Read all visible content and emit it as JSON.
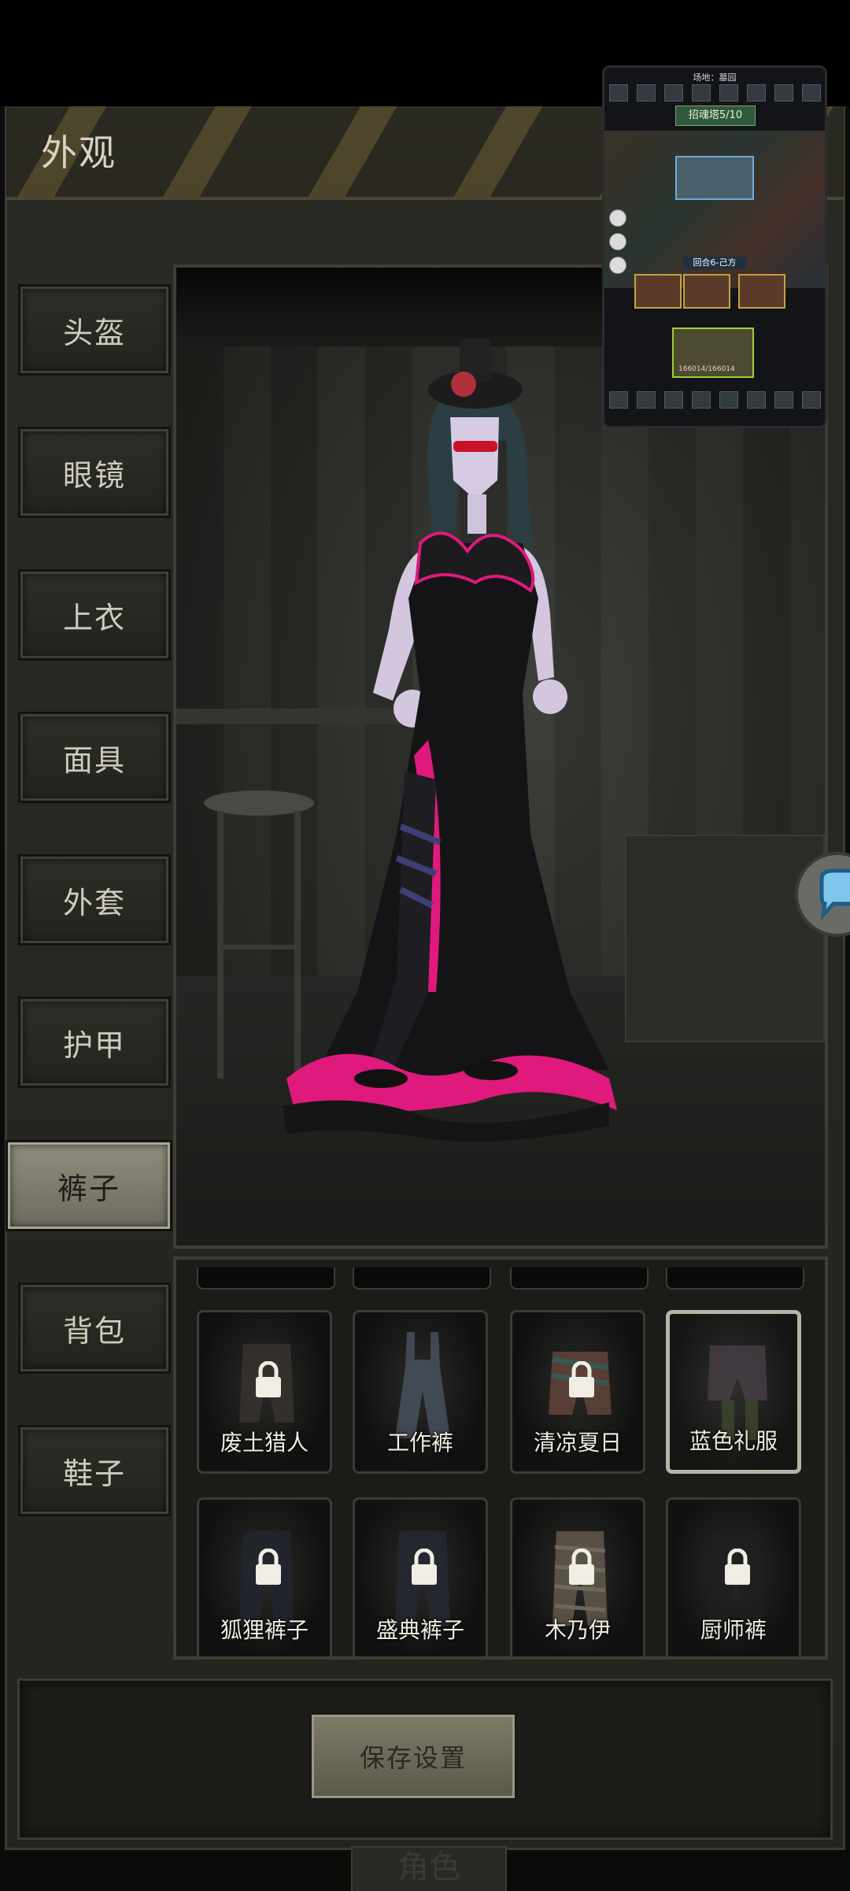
{
  "header": {
    "title": "外观"
  },
  "categories": [
    "头盔",
    "眼镜",
    "上衣",
    "面具",
    "外套",
    "护甲",
    "裤子",
    "背包",
    "鞋子"
  ],
  "active_category": "裤子",
  "items": [
    {
      "label": "废土猎人",
      "locked": true,
      "selected": false
    },
    {
      "label": "工作裤",
      "locked": false,
      "selected": false
    },
    {
      "label": "清凉夏日",
      "locked": true,
      "selected": false
    },
    {
      "label": "蓝色礼服",
      "locked": false,
      "selected": true
    },
    {
      "label": "狐狸裤子",
      "locked": true,
      "selected": false
    },
    {
      "label": "盛典裤子",
      "locked": true,
      "selected": false
    },
    {
      "label": "木乃伊",
      "locked": true,
      "selected": false
    },
    {
      "label": "厨师裤",
      "locked": true,
      "selected": false
    }
  ],
  "save_button": {
    "label": "保存设置"
  },
  "bottom_peek": {
    "label": "角色"
  },
  "mini_window": {
    "arena": "场地：墓园",
    "banner": "招魂塔5/10",
    "round": "回合6-己方",
    "boss_hp": "166014/166014"
  },
  "colors": {
    "accent_pink": "#e0197d",
    "selected_border": "#b8b3a4",
    "save_button": "#6e6c5a"
  }
}
